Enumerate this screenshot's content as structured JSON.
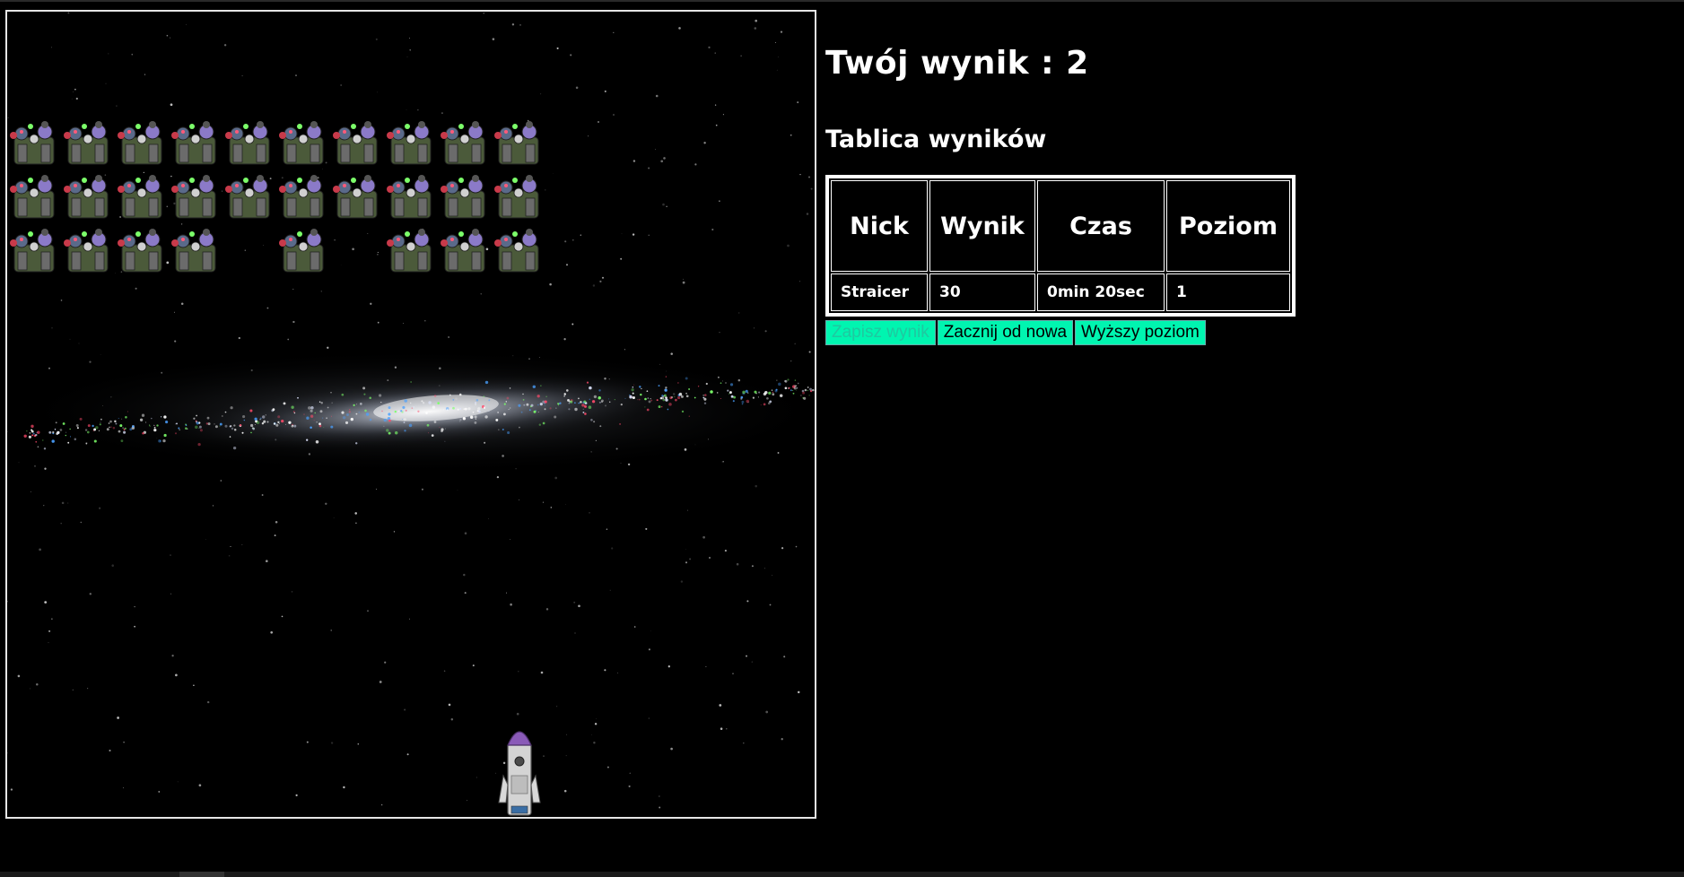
{
  "score_heading": "Twój wynik : 2",
  "leaderboard": {
    "title": "Tablica wyników",
    "columns": [
      "Nick",
      "Wynik",
      "Czas",
      "Poziom"
    ],
    "rows": [
      [
        "Straicer",
        "30",
        "0min 20sec",
        "1"
      ]
    ]
  },
  "buttons": {
    "save": "Zapisz wynik",
    "restart": "Zacznij od nowa",
    "next_level": "Wyższy poziom"
  },
  "game": {
    "enemy_rows": [
      [
        1,
        1,
        1,
        1,
        1,
        1,
        1,
        1,
        1,
        1
      ],
      [
        1,
        1,
        1,
        1,
        1,
        1,
        1,
        1,
        1,
        1
      ],
      [
        1,
        1,
        1,
        1,
        0,
        1,
        0,
        1,
        1,
        1
      ]
    ],
    "enemy_icon": "alien-robot-icon",
    "player_icon": "rocket-icon"
  },
  "colors": {
    "background": "#000000",
    "button": "#00f5b0",
    "text": "#ffffff"
  }
}
